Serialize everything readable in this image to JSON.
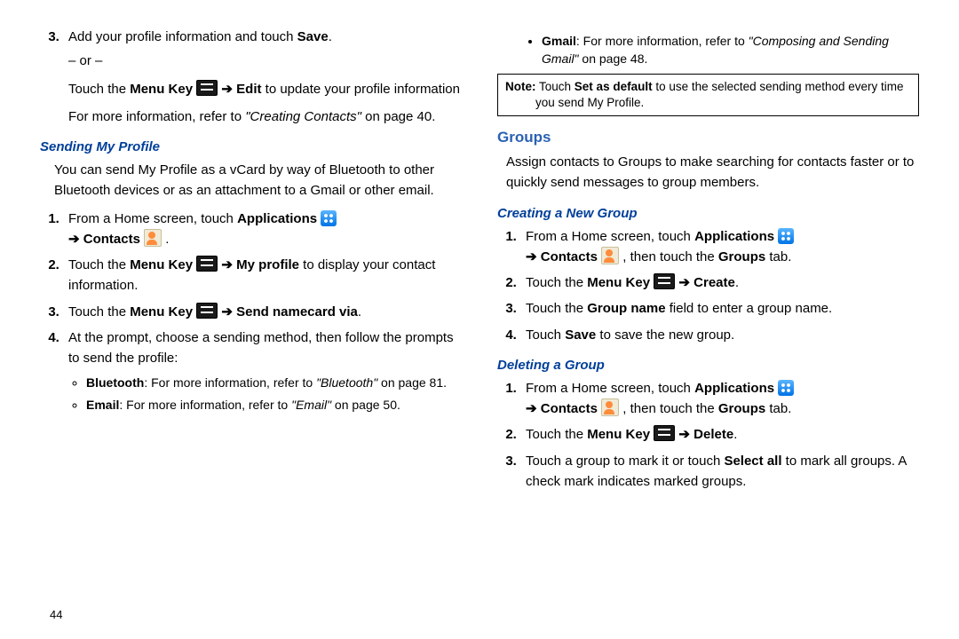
{
  "leftCol": {
    "step3a_prefix": "Add your profile information and touch ",
    "step3a_bold": "Save",
    "step3a_suffix": ".",
    "or": "– or –",
    "step3b_1": "Touch the ",
    "step3b_menuKey": "Menu Key",
    "step3b_arrow": " ➔ ",
    "step3b_edit": "Edit",
    "step3b_suffix": " to update your profile information",
    "step3c_1": "For more information, refer to ",
    "step3c_ref": "\"Creating Contacts\"",
    "step3c_2": " on page 40.",
    "sendingHeader": "Sending My Profile",
    "sendingIntro": "You can send My Profile as a vCard by way of Bluetooth to other Bluetooth devices or as an attachment to a Gmail or other email.",
    "s1_a": "From a Home screen, touch ",
    "s1_apps": "Applications",
    "s1_arrow": " ➔ ",
    "s1_contacts": "Contacts",
    "s1_dot": " .",
    "s2_a": "Touch the ",
    "s2_menuKey": "Menu Key",
    "s2_arrow": " ➔ ",
    "s2_myprofile": "My profile",
    "s2_suffix": " to display your contact information.",
    "s3_a": "Touch the ",
    "s3_menuKey": "Menu Key",
    "s3_arrow": " ➔ ",
    "s3_send": "Send namecard via",
    "s3_dot": ".",
    "s4": "At the prompt, choose a sending method, then follow the prompts to send the profile:",
    "b_bt_b": "Bluetooth",
    "b_bt_1": ": For more information, refer to ",
    "b_bt_ref": "\"Bluetooth\"",
    "b_bt_2": " on page 81.",
    "b_em_b": "Email",
    "b_em_1": ": For more information, refer to ",
    "b_em_ref": "\"Email\"",
    "b_em_2": " on page 50."
  },
  "rightCol": {
    "b_gm_b": "Gmail",
    "b_gm_1": ": For more information, refer to ",
    "b_gm_ref": "\"Composing and Sending Gmail\"",
    "b_gm_2": " on page 48.",
    "note_b1": "Note:",
    "note_t1": " Touch ",
    "note_b2": "Set as default",
    "note_t2": " to use the selected sending method every time ",
    "note_t3": "you send My Profile.",
    "groupsHeader": "Groups",
    "groupsIntro": "Assign contacts to Groups to make searching for contacts faster or to quickly send messages to group members.",
    "createHeader": "Creating a New Group",
    "c1_a": "From a Home screen, touch ",
    "c1_apps": "Applications",
    "c1_arrow": " ➔ ",
    "c1_contacts": "Contacts",
    "c1_then": " , then touch the ",
    "c1_groups": "Groups",
    "c1_tab": " tab.",
    "c2_a": "Touch the ",
    "c2_menuKey": "Menu Key",
    "c2_arrow": " ➔ ",
    "c2_create": "Create",
    "c2_dot": ".",
    "c3_a": "Touch the ",
    "c3_b": "Group name",
    "c3_suffix": " field to enter a group name.",
    "c4_a": "Touch ",
    "c4_b": "Save",
    "c4_suffix": " to save the new group.",
    "deleteHeader": "Deleting a Group",
    "d1_a": "From a Home screen, touch ",
    "d1_apps": "Applications",
    "d1_arrow": " ➔ ",
    "d1_contacts": "Contacts",
    "d1_then": " , then touch the ",
    "d1_groups": "Groups",
    "d1_tab": " tab.",
    "d2_a": "Touch the ",
    "d2_menuKey": "Menu Key",
    "d2_arrow": " ➔ ",
    "d2_delete": "Delete",
    "d2_dot": ".",
    "d3_a": "Touch a group to mark it or touch ",
    "d3_b": "Select all",
    "d3_suffix": " to mark all groups. A check mark indicates marked groups."
  },
  "pageNumber": "44"
}
